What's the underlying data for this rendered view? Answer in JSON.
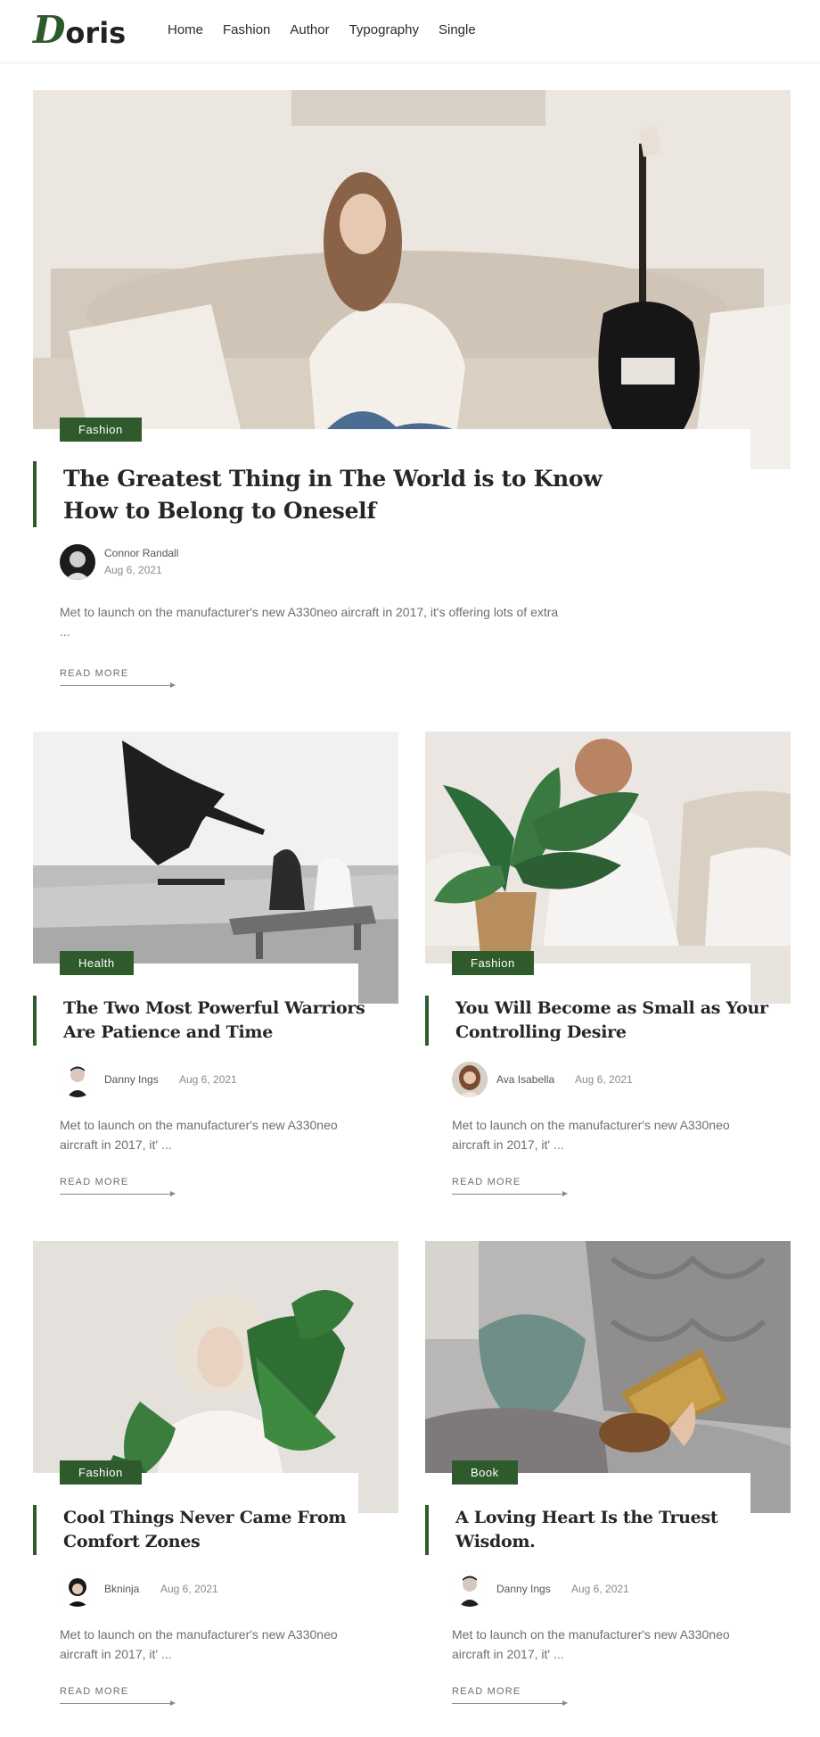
{
  "brand": {
    "logo_initial": "D",
    "logo_rest": "oris"
  },
  "nav": [
    {
      "label": "Home"
    },
    {
      "label": "Fashion"
    },
    {
      "label": "Author"
    },
    {
      "label": "Typography"
    },
    {
      "label": "Single"
    }
  ],
  "featured": {
    "category": "Fashion",
    "title_line1": "The Greatest Thing in The World is to Know",
    "title_line2": "How to Belong to Oneself",
    "author": "Connor Randall",
    "date": "Aug 6, 2021",
    "excerpt_line1": "Met to launch on the manufacturer's new A330neo aircraft in 2017, it's offering lots of extra",
    "excerpt_line2": "...",
    "read_more": "READ MORE"
  },
  "posts": [
    {
      "category": "Health",
      "title_line1": "The Two Most Powerful Warriors",
      "title_line2": "Are Patience and Time",
      "author": "Danny Ings",
      "date": "Aug 6, 2021",
      "excerpt_line1": "Met to launch on the manufacturer's new A330neo",
      "excerpt_line2": "aircraft in 2017, it' ...",
      "read_more": "READ MORE"
    },
    {
      "category": "Fashion",
      "title_line1": "You Will Become as Small as Your",
      "title_line2": "Controlling Desire",
      "author": "Ava Isabella",
      "date": "Aug 6, 2021",
      "excerpt_line1": "Met to launch on the manufacturer's new A330neo",
      "excerpt_line2": "aircraft in 2017, it' ...",
      "read_more": "READ MORE"
    },
    {
      "category": "Fashion",
      "title_line1": "Cool Things Never Came From",
      "title_line2": "Comfort Zones",
      "author": "Bkninja",
      "date": "Aug 6, 2021",
      "excerpt_line1": "Met to launch on the manufacturer's new A330neo",
      "excerpt_line2": "aircraft in 2017, it' ...",
      "read_more": "READ MORE"
    },
    {
      "category": "Book",
      "title_line1": "A Loving Heart Is the Truest",
      "title_line2": "Wisdom.",
      "author": "Danny Ings",
      "date": "Aug 6, 2021",
      "excerpt_line1": "Met to launch on the manufacturer's new A330neo",
      "excerpt_line2": "aircraft in 2017, it' ...",
      "read_more": "READ MORE"
    }
  ],
  "colors": {
    "accent": "#2f5a2c",
    "text": "#262626",
    "muted": "#6e6e6e"
  }
}
